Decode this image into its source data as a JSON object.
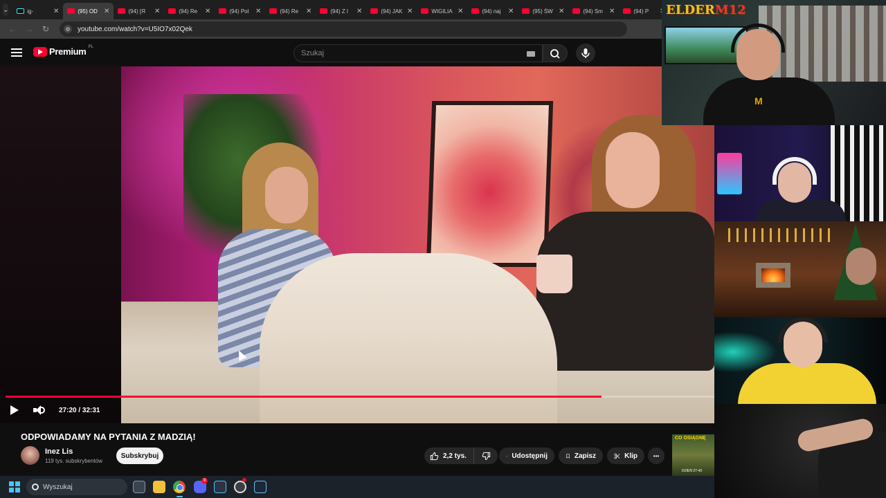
{
  "browser": {
    "tabs": [
      {
        "label": "ig-",
        "favicon": "tiktok-icon",
        "active": false
      },
      {
        "label": "(95) OD",
        "favicon": "youtube-icon",
        "active": true
      },
      {
        "label": "(94) [Я",
        "favicon": "youtube-icon",
        "active": false
      },
      {
        "label": "(94) Re",
        "favicon": "youtube-icon",
        "active": false
      },
      {
        "label": "(94) Pol",
        "favicon": "youtube-icon",
        "active": false
      },
      {
        "label": "(94) Re",
        "favicon": "youtube-icon",
        "active": false
      },
      {
        "label": "(94) Z l",
        "favicon": "youtube-icon",
        "active": false
      },
      {
        "label": "(94) JAK",
        "favicon": "youtube-icon",
        "active": false
      },
      {
        "label": "WIGILIA",
        "favicon": "youtube-icon",
        "active": false
      },
      {
        "label": "(94) naj",
        "favicon": "youtube-icon",
        "active": false
      },
      {
        "label": "(95) ŚW",
        "favicon": "youtube-icon",
        "active": false
      },
      {
        "label": "(94) Sm",
        "favicon": "youtube-icon",
        "active": false
      },
      {
        "label": "(94) P",
        "favicon": "youtube-icon",
        "active": false
      }
    ],
    "url": "youtube.com/watch?v=U5IO7x02Qek"
  },
  "youtube": {
    "logo_text": "Premium",
    "logo_country": "PL",
    "search_placeholder": "Szukaj",
    "player": {
      "time_display": "27:20 / 32:31",
      "progress": 0.8407
    },
    "video": {
      "title": "ODPOWIADAMY NA PYTANIA Z MADZIĄ!",
      "channel_name": "Inez Lis",
      "subscribers": "119 tys. subskrybentów",
      "subscribe_label": "Subskrybuj",
      "like_count": "2,2 tys.",
      "share_label": "Udostępnij",
      "save_label": "Zapisz",
      "clip_label": "Klip",
      "more_label": "•••"
    },
    "recommended_thumb_text": "CO OSIĄGNĘ",
    "recommended_thumb_small": "DZIEŃ 27-43"
  },
  "overlay": {
    "streamer_label_a": "ELDER",
    "streamer_label_b": "M12"
  },
  "taskbar": {
    "search_placeholder": "Wyszukaj",
    "discord_badge": "9"
  },
  "colors": {
    "youtube_red": "#ff0033",
    "background": "#0f0f0f",
    "accent_blue": "#4cc2ff"
  }
}
